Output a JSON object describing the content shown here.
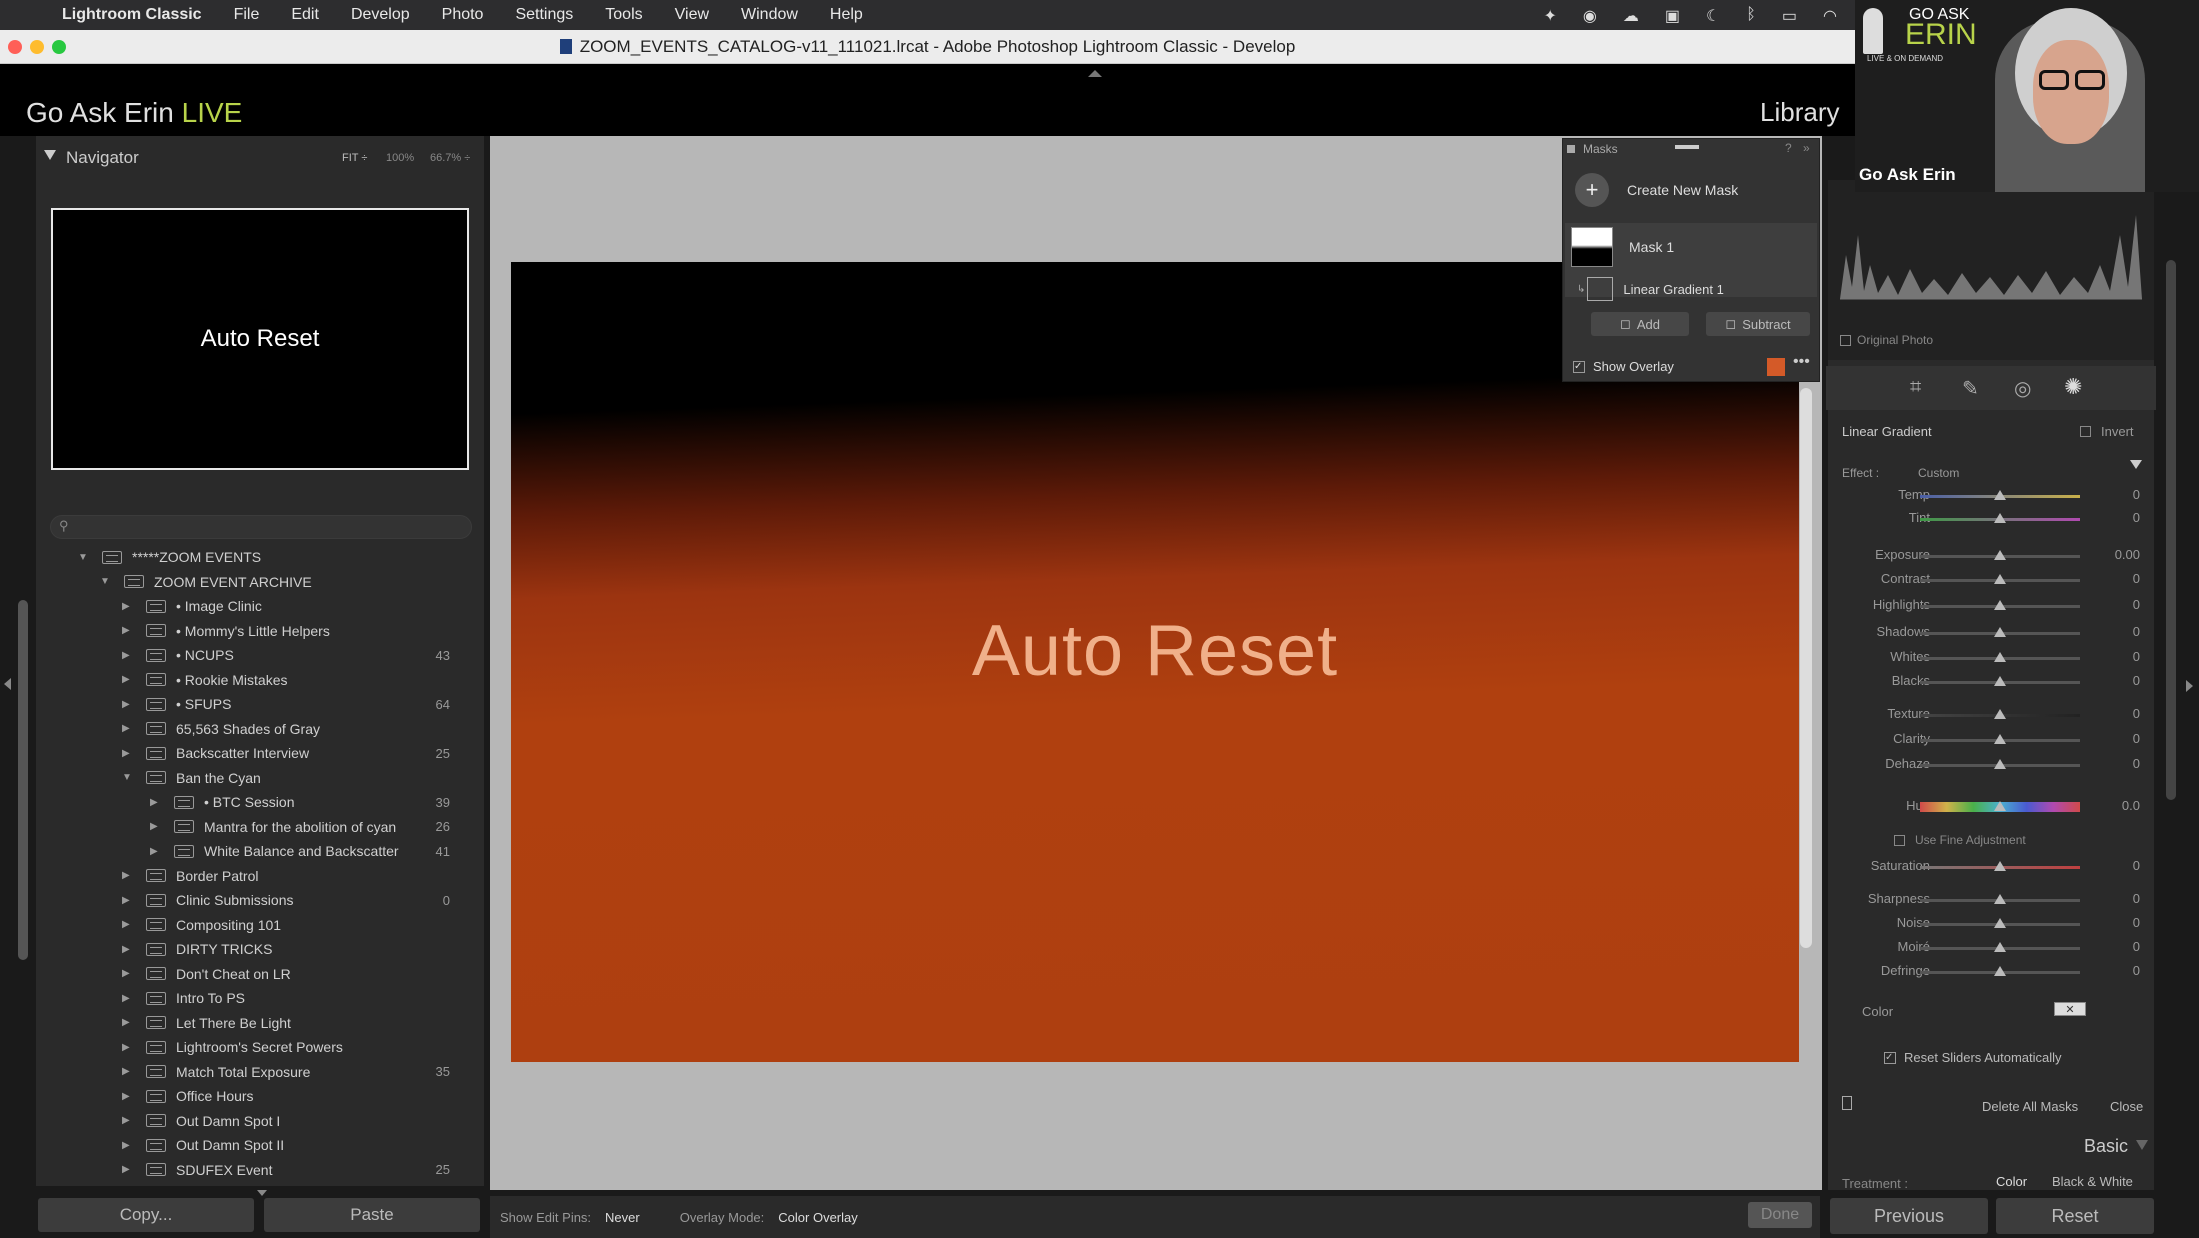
{
  "menubar": {
    "items": [
      "Lightroom Classic",
      "File",
      "Edit",
      "Develop",
      "Photo",
      "Settings",
      "Tools",
      "View",
      "Window",
      "Help"
    ]
  },
  "window": {
    "title": "ZOOM_EVENTS_CATALOG-v11_111021.lrcat - Adobe Photoshop Lightroom Classic - Develop"
  },
  "identity": {
    "brand_main": "Go Ask Erin ",
    "brand_live": "LIVE",
    "module": "Library"
  },
  "navigator": {
    "title": "Navigator",
    "zoom_options": [
      "FIT ÷",
      "100%",
      "66.7% ÷"
    ],
    "preview_text": "Auto Reset"
  },
  "collections": [
    {
      "name": "*****ZOOM EVENTS",
      "level": 0,
      "expanded": true,
      "count": ""
    },
    {
      "name": "ZOOM EVENT ARCHIVE",
      "level": 1,
      "expanded": true,
      "count": ""
    },
    {
      "name": "• Image Clinic",
      "level": 2,
      "expanded": false,
      "count": ""
    },
    {
      "name": "• Mommy's Little Helpers",
      "level": 2,
      "expanded": false,
      "count": ""
    },
    {
      "name": "• NCUPS",
      "level": 2,
      "expanded": false,
      "count": "43"
    },
    {
      "name": "• Rookie Mistakes",
      "level": 2,
      "expanded": false,
      "count": ""
    },
    {
      "name": "• SFUPS",
      "level": 2,
      "expanded": false,
      "count": "64"
    },
    {
      "name": "65,563 Shades of Gray",
      "level": 2,
      "expanded": false,
      "count": ""
    },
    {
      "name": "Backscatter Interview",
      "level": 2,
      "expanded": false,
      "count": "25"
    },
    {
      "name": "Ban the Cyan",
      "level": 2,
      "expanded": true,
      "count": ""
    },
    {
      "name": "• BTC Session",
      "level": 3,
      "expanded": false,
      "count": "39"
    },
    {
      "name": "Mantra for the abolition of cyan",
      "level": 3,
      "expanded": false,
      "count": "26"
    },
    {
      "name": "White Balance and Backscatter",
      "level": 3,
      "expanded": false,
      "count": "41"
    },
    {
      "name": "Border Patrol",
      "level": 2,
      "expanded": false,
      "count": ""
    },
    {
      "name": "Clinic Submissions",
      "level": 2,
      "expanded": false,
      "count": "0"
    },
    {
      "name": "Compositing 101",
      "level": 2,
      "expanded": false,
      "count": ""
    },
    {
      "name": "DIRTY TRICKS",
      "level": 2,
      "expanded": false,
      "count": ""
    },
    {
      "name": "Don't Cheat on LR",
      "level": 2,
      "expanded": false,
      "count": ""
    },
    {
      "name": "Intro To PS",
      "level": 2,
      "expanded": false,
      "count": ""
    },
    {
      "name": "Let There Be Light",
      "level": 2,
      "expanded": false,
      "count": ""
    },
    {
      "name": "Lightroom's Secret Powers",
      "level": 2,
      "expanded": false,
      "count": ""
    },
    {
      "name": "Match Total Exposure",
      "level": 2,
      "expanded": false,
      "count": "35"
    },
    {
      "name": "Office Hours",
      "level": 2,
      "expanded": false,
      "count": ""
    },
    {
      "name": "Out Damn Spot I",
      "level": 2,
      "expanded": false,
      "count": ""
    },
    {
      "name": "Out Damn Spot II",
      "level": 2,
      "expanded": false,
      "count": ""
    },
    {
      "name": "SDUFEX Event",
      "level": 2,
      "expanded": false,
      "count": "25"
    }
  ],
  "left_buttons": {
    "copy": "Copy...",
    "paste": "Paste"
  },
  "photo": {
    "overlay_text": "Auto Reset"
  },
  "toolbar": {
    "edit_pins_label": "Show Edit Pins:",
    "edit_pins_value": "Never",
    "overlay_mode_label": "Overlay Mode:",
    "overlay_mode_value": "Color Overlay",
    "done": "Done"
  },
  "masks_panel": {
    "title": "Masks",
    "create_new": "Create New Mask",
    "mask_name": "Mask 1",
    "component": "Linear Gradient 1",
    "add": "Add",
    "subtract": "Subtract",
    "show_overlay": "Show Overlay",
    "overlay_color": "#d45a28"
  },
  "right_panel": {
    "original_photo": "Original Photo",
    "tool_name": "Linear Gradient",
    "invert": "Invert",
    "effect_label": "Effect :",
    "effect_value": "Custom",
    "use_fine": "Use Fine Adjustment",
    "color_label": "Color",
    "reset_sliders": "Reset Sliders Automatically",
    "delete_all": "Delete All Masks",
    "close": "Close",
    "basic": "Basic",
    "treatment": "Treatment :",
    "treat_color": "Color",
    "treat_bw": "Black & White",
    "previous": "Previous",
    "reset": "Reset"
  },
  "sliders": [
    {
      "label": "Temp",
      "value": "0",
      "level": 0.5
    },
    {
      "label": "Tint",
      "value": "0",
      "level": 0.5
    },
    {
      "label": "Exposure",
      "value": "0.00",
      "level": 0.5
    },
    {
      "label": "Contrast",
      "value": "0",
      "level": 0.5
    },
    {
      "label": "Highlights",
      "value": "0",
      "level": 0.5
    },
    {
      "label": "Shadows",
      "value": "0",
      "level": 0.5
    },
    {
      "label": "Whites",
      "value": "0",
      "level": 0.5
    },
    {
      "label": "Blacks",
      "value": "0",
      "level": 0.5
    },
    {
      "label": "Texture",
      "value": "0",
      "level": 0.5
    },
    {
      "label": "Clarity",
      "value": "0",
      "level": 0.5
    },
    {
      "label": "Dehaze",
      "value": "0",
      "level": 0.5
    },
    {
      "label": "Hue",
      "value": "0.0",
      "level": 0.5
    },
    {
      "label": "Saturation",
      "value": "0",
      "level": 0.5
    },
    {
      "label": "Sharpness",
      "value": "0",
      "level": 0.5
    },
    {
      "label": "Noise",
      "value": "0",
      "level": 0.5
    },
    {
      "label": "Moiré",
      "value": "0",
      "level": 0.5
    },
    {
      "label": "Defringe",
      "value": "0",
      "level": 0.5
    }
  ],
  "webcam": {
    "logo_top": "GO ASK",
    "logo_main": "ERIN",
    "logo_sub": "LIVE & ON DEMAND",
    "name": "Go Ask Erin"
  }
}
